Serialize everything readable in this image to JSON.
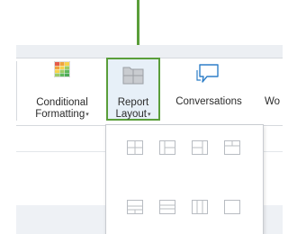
{
  "ribbon": {
    "conditional_formatting": {
      "line1": "Conditional",
      "line2": "Formatting",
      "caret": "▾",
      "icon": "conditional-formatting-icon"
    },
    "report_layout": {
      "line1": "Report",
      "line2": "Layout",
      "caret": "▾",
      "icon": "report-layout-icon",
      "highlighted": true
    },
    "conversations": {
      "label": "Conversations",
      "icon": "speech-bubble-icon"
    },
    "partial_next": {
      "label": "Wo"
    }
  },
  "report_layout_menu": {
    "options": [
      {
        "icon": "layout-grid-2x2-icon"
      },
      {
        "icon": "layout-left-column-icon"
      },
      {
        "icon": "layout-right-column-icon"
      },
      {
        "icon": "layout-top-row-icon"
      },
      {
        "icon": "layout-bottom-split-icon"
      },
      {
        "icon": "layout-rows-icon"
      },
      {
        "icon": "layout-columns-icon"
      },
      {
        "icon": "layout-blank-icon"
      }
    ]
  },
  "colors": {
    "highlight_border": "#5a9e3a",
    "highlight_fill": "#e7f0f8",
    "icon_gray": "#b8bcc2"
  }
}
